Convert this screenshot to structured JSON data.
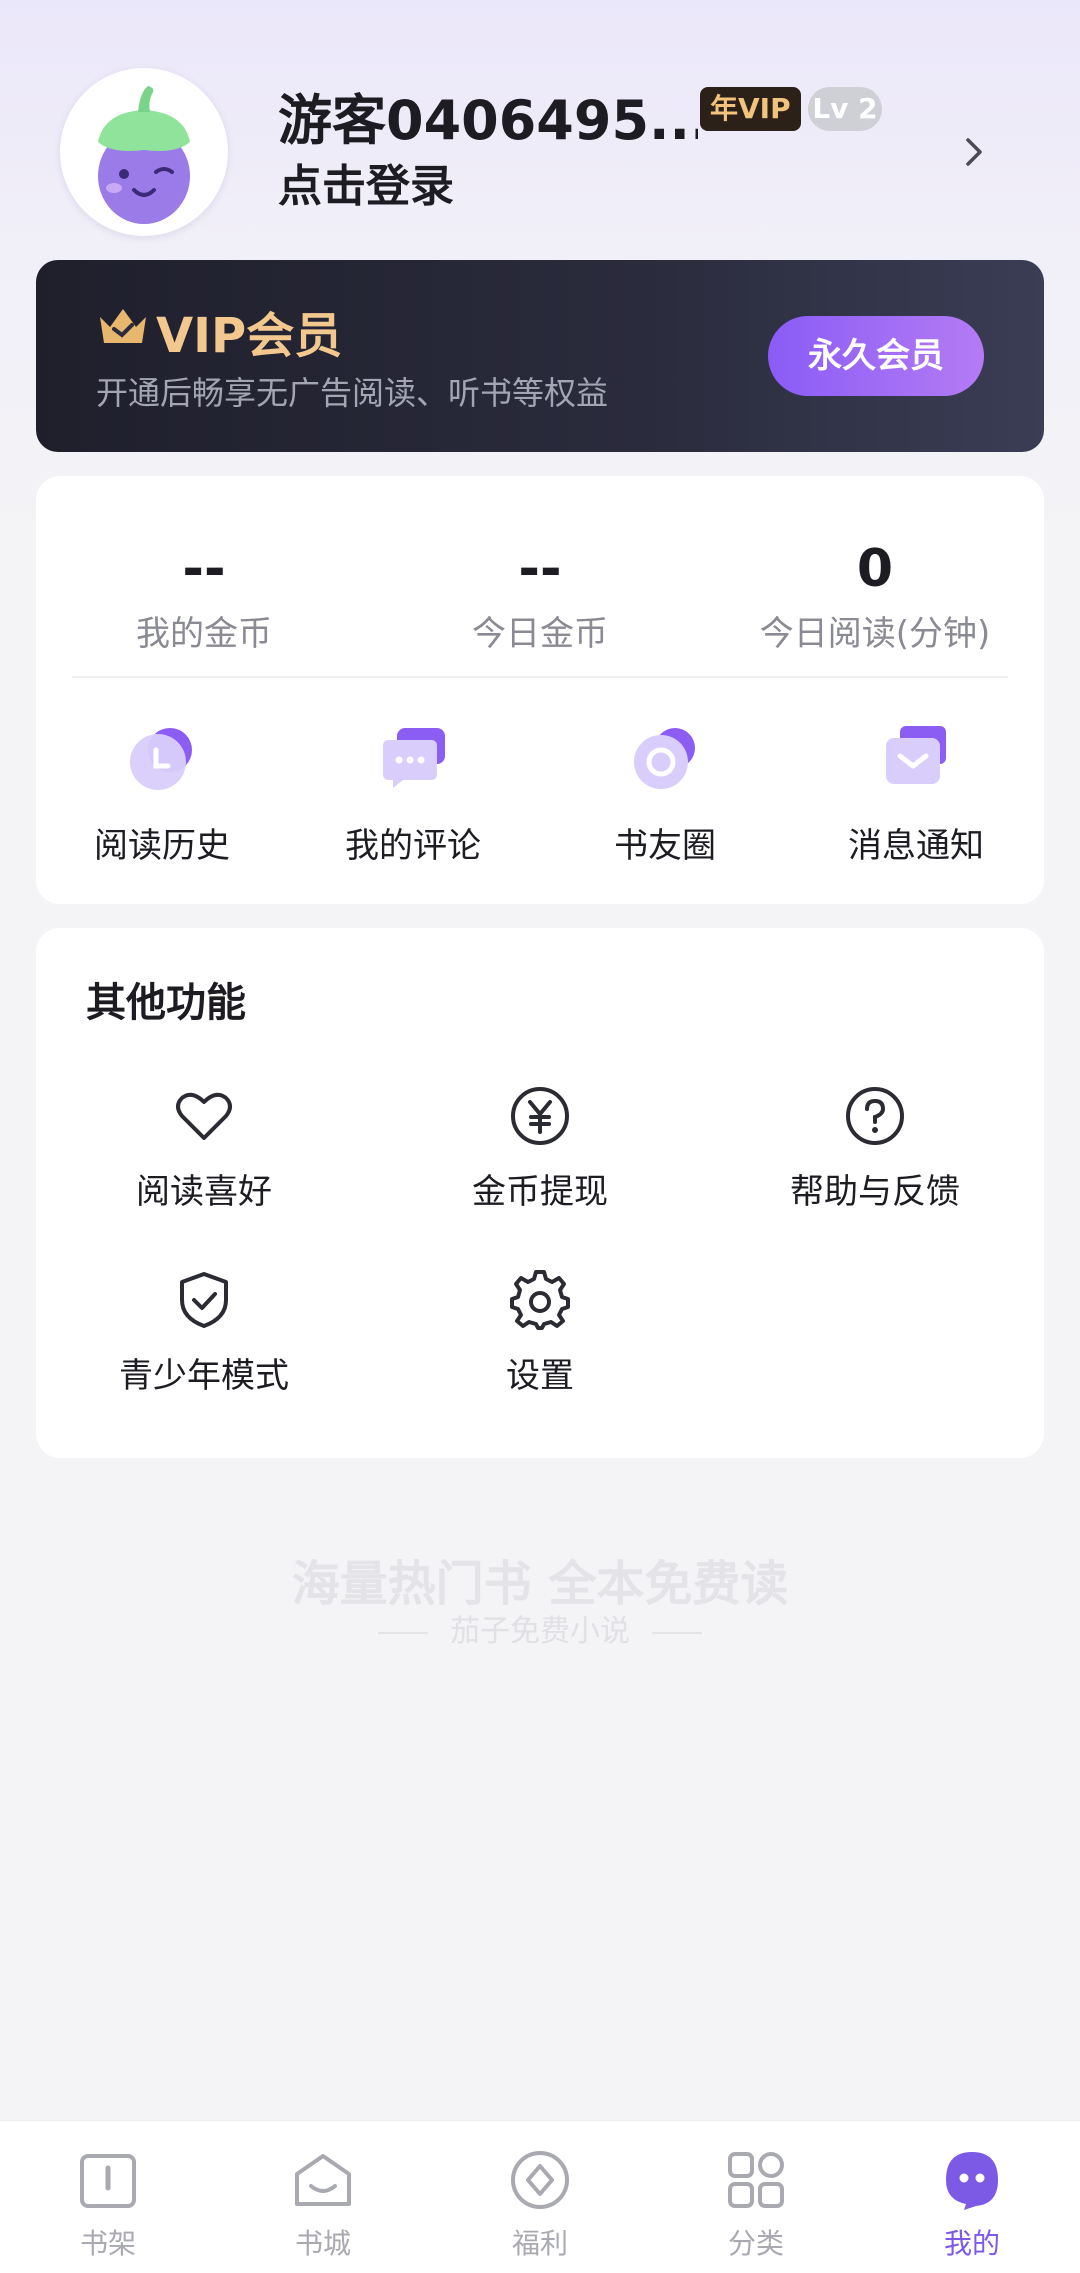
{
  "header": {
    "username": "游客0406495...",
    "vip_badge": "年VIP",
    "level_badge": "Lv 2",
    "login_prompt": "点击登录"
  },
  "vip_banner": {
    "title": "VIP会员",
    "subtitle": "开通后畅享无广告阅读、听书等权益",
    "button": "永久会员"
  },
  "stats": [
    {
      "value": "--",
      "label": "我的金币"
    },
    {
      "value": "--",
      "label": "今日金币"
    },
    {
      "value": "0",
      "label": "今日阅读(分钟)"
    }
  ],
  "quick_actions": [
    {
      "label": "阅读历史",
      "icon": "clock-icon"
    },
    {
      "label": "我的评论",
      "icon": "comment-icon"
    },
    {
      "label": "书友圈",
      "icon": "circle-icon"
    },
    {
      "label": "消息通知",
      "icon": "message-icon"
    }
  ],
  "other": {
    "title": "其他功能",
    "items": [
      {
        "label": "阅读喜好",
        "icon": "heart-icon"
      },
      {
        "label": "金币提现",
        "icon": "yen-icon"
      },
      {
        "label": "帮助与反馈",
        "icon": "help-icon"
      },
      {
        "label": "青少年模式",
        "icon": "shield-icon"
      },
      {
        "label": "设置",
        "icon": "gear-icon"
      }
    ]
  },
  "slogan": {
    "main": "海量热门书 全本免费读",
    "sub": "茄子免费小说"
  },
  "tabs": [
    {
      "label": "书架",
      "icon": "bookshelf-icon"
    },
    {
      "label": "书城",
      "icon": "bookstore-icon"
    },
    {
      "label": "福利",
      "icon": "welfare-icon"
    },
    {
      "label": "分类",
      "icon": "category-icon"
    },
    {
      "label": "我的",
      "icon": "profile-icon",
      "active": true
    }
  ],
  "colors": {
    "accent": "#7c5ae6",
    "vip_gold": "#f2c88e",
    "banner_dark": "#1f1f2c"
  }
}
